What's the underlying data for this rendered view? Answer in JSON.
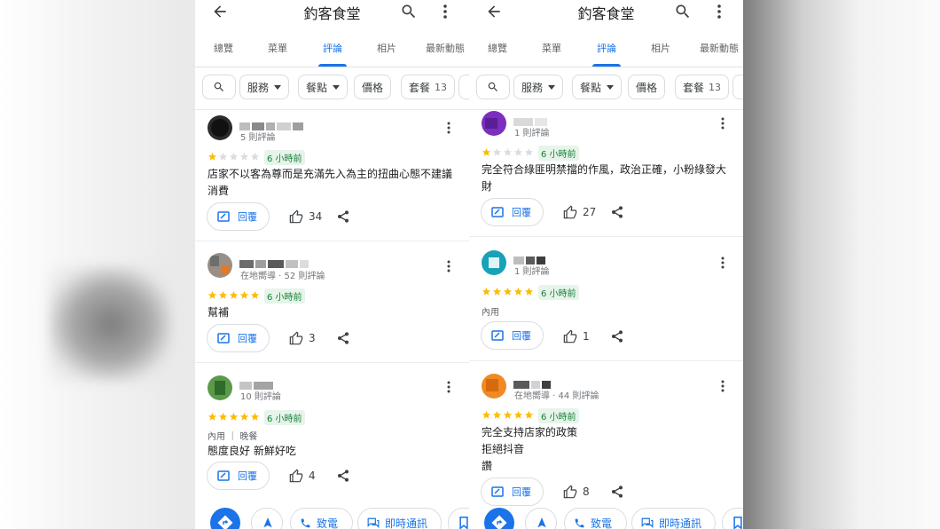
{
  "screens": [
    {
      "title": "釣客食堂",
      "tabs": [
        "總覽",
        "菜單",
        "評論",
        "相片",
        "最新動態"
      ],
      "active_tab": "評論",
      "chips": {
        "services": "服務",
        "meals": "餐點",
        "price": "價格",
        "set": "套餐",
        "set_count": "13"
      },
      "reviews": [
        {
          "meta": "5 則評論",
          "time": "6 小時前",
          "rating": 1,
          "tags": "",
          "text": "店家不以客為尊而是充滿先入為主的扭曲心態不建議消費",
          "reply": "回覆",
          "likes": "34"
        },
        {
          "meta": "在地嚮導 · 52 則評論",
          "time": "6 小時前",
          "rating": 5,
          "tags": "",
          "text": "幫補",
          "reply": "回覆",
          "likes": "3"
        },
        {
          "meta": "10 則評論",
          "time": "6 小時前",
          "rating": 5,
          "tags": "內用 ｜ 晚餐",
          "text": "態度良好 新鮮好吃",
          "reply": "回覆",
          "likes": "4"
        }
      ],
      "bottom": {
        "call": "致電",
        "chat": "即時通訊"
      }
    },
    {
      "title": "釣客食堂",
      "tabs": [
        "總覽",
        "菜單",
        "評論",
        "相片",
        "最新動態"
      ],
      "active_tab": "評論",
      "chips": {
        "services": "服務",
        "meals": "餐點",
        "price": "價格",
        "set": "套餐",
        "set_count": "13"
      },
      "reviews": [
        {
          "meta": "1 則評論",
          "time": "6 小時前",
          "rating": 1,
          "tags": "",
          "text": "完全符合綠匪明禁擋的作風，政治正確，小粉綠發大財",
          "reply": "回覆",
          "likes": "27"
        },
        {
          "meta": "1 則評論",
          "time": "6 小時前",
          "rating": 5,
          "tags": "內用",
          "text": "",
          "reply": "回覆",
          "likes": "1"
        },
        {
          "meta": "在地嚮導 · 44 則評論",
          "time": "6 小時前",
          "rating": 5,
          "tags": "",
          "text": "完全支持店家的政策\n拒絕抖音\n讚",
          "reply": "回覆",
          "likes": "8"
        }
      ],
      "bottom": {
        "call": "致電",
        "chat": "即時通訊"
      }
    }
  ],
  "colors": {
    "accent": "#1a73e8",
    "star": "#fbbc04",
    "star_empty": "#dadce0",
    "time_bg": "#e6f4ea",
    "time_fg": "#188038"
  },
  "icons": {
    "back": "arrow-left-icon",
    "search": "search-icon",
    "more": "more-vert-icon",
    "reply": "reply-icon",
    "like": "thumb-up-icon",
    "share": "share-icon",
    "directions": "directions-icon",
    "navigate": "navigation-icon",
    "call": "phone-icon",
    "chat": "chat-icon",
    "save": "bookmark-icon"
  }
}
